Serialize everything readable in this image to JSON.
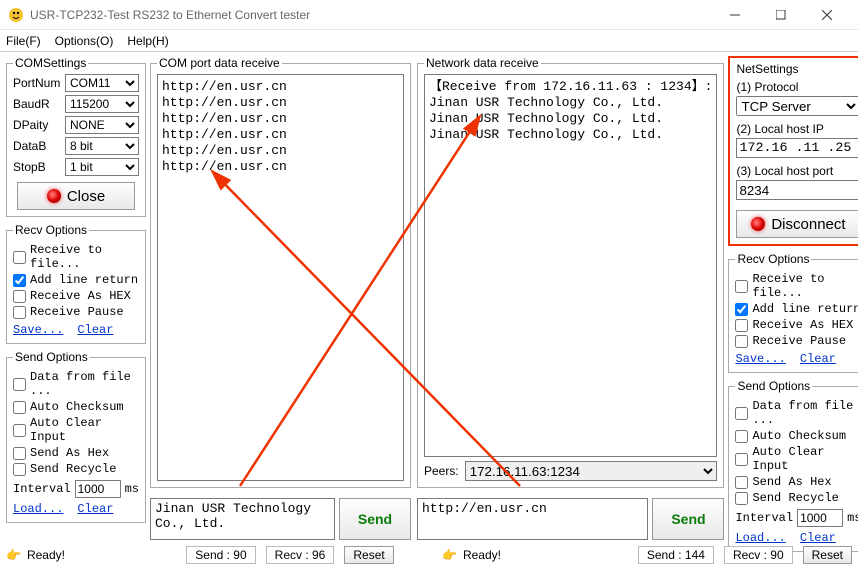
{
  "window": {
    "title": "USR-TCP232-Test  RS232 to Ethernet Convert tester"
  },
  "menu": {
    "file": "File(F)",
    "options": "Options(O)",
    "help": "Help(H)"
  },
  "comSettings": {
    "legend": "COMSettings",
    "portnum_label": "PortNum",
    "portnum": "COM11",
    "baud_label": "BaudR",
    "baud": "115200",
    "parity_label": "DPaity",
    "parity": "NONE",
    "datab_label": "DataB",
    "datab": "8 bit",
    "stopb_label": "StopB",
    "stopb": "1 bit",
    "close": "Close"
  },
  "recvOptions": {
    "legend": "Recv Options",
    "receive_to_file": "Receive to file...",
    "add_line_return": "Add line return",
    "receive_as_hex": "Receive As HEX",
    "receive_pause": "Receive Pause",
    "save": "Save...",
    "clear": "Clear"
  },
  "sendOptions": {
    "legend": "Send Options",
    "data_from_file": "Data from file ...",
    "auto_checksum": "Auto Checksum",
    "auto_clear_input": "Auto Clear Input",
    "send_as_hex": "Send As Hex",
    "send_recycle": "Send Recycle",
    "interval_label": "Interval",
    "interval_value": "1000",
    "interval_unit": "ms",
    "load": "Load...",
    "clear": "Clear"
  },
  "comPanel": {
    "legend": "COM port data receive",
    "lines": "http://en.usr.cn\nhttp://en.usr.cn\nhttp://en.usr.cn\nhttp://en.usr.cn\nhttp://en.usr.cn\nhttp://en.usr.cn",
    "send_text": "Jinan USR Technology Co., Ltd.",
    "send_btn": "Send"
  },
  "netPanel": {
    "legend": "Network data receive",
    "lines": "【Receive from 172.16.11.63 : 1234】:\nJinan USR Technology Co., Ltd.\nJinan USR Technology Co., Ltd.\nJinan USR Technology Co., Ltd.",
    "peers_label": "Peers:",
    "peers_value": "172.16.11.63:1234",
    "send_text": "http://en.usr.cn",
    "send_btn": "Send"
  },
  "netSettings": {
    "legend": "NetSettings",
    "protocol_label": "(1) Protocol",
    "protocol": "TCP Server",
    "localip_label": "(2) Local host IP",
    "localip": "172.16 .11 .25",
    "localport_label": "(3) Local host port",
    "localport": "8234",
    "disconnect": "Disconnect"
  },
  "footer": {
    "ready": "Ready!",
    "com_send": "Send : 90",
    "com_recv": "Recv : 96",
    "com_reset": "Reset",
    "net_send": "Send : 144",
    "net_recv": "Recv : 90",
    "net_reset": "Reset"
  }
}
